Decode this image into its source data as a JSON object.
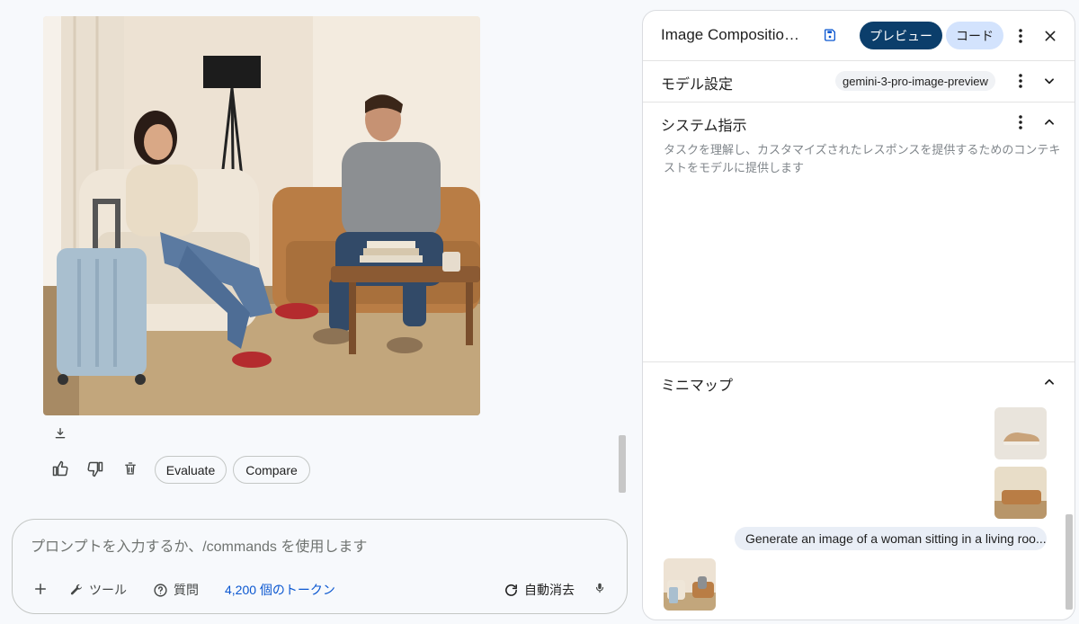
{
  "chat": {
    "actions": {
      "evaluate_label": "Evaluate",
      "compare_label": "Compare"
    },
    "prompt": {
      "placeholder": "プロンプトを入力するか、/commands を使用します",
      "tools_label": "ツール",
      "question_label": "質問",
      "token_count": "4,200 個のトークン",
      "auto_clear_label": "自動消去"
    }
  },
  "panel": {
    "title": "Image Composition ...",
    "preview_label": "プレビュー",
    "code_label": "コード",
    "model_settings": {
      "label": "モデル設定",
      "model_name": "gemini-3-pro-image-preview"
    },
    "system_instructions": {
      "label": "システム指示",
      "placeholder": "タスクを理解し、カスタマイズされたレスポンスを提供するためのコンテキストをモデルに提供します"
    },
    "minimap": {
      "label": "ミニマップ",
      "prompt_preview": "Generate an image of a woman sitting in a living roo..."
    }
  },
  "colors": {
    "accent_blue": "#0b57d0",
    "preview_button": "#0b3e6b",
    "code_button": "#d3e3fd"
  }
}
